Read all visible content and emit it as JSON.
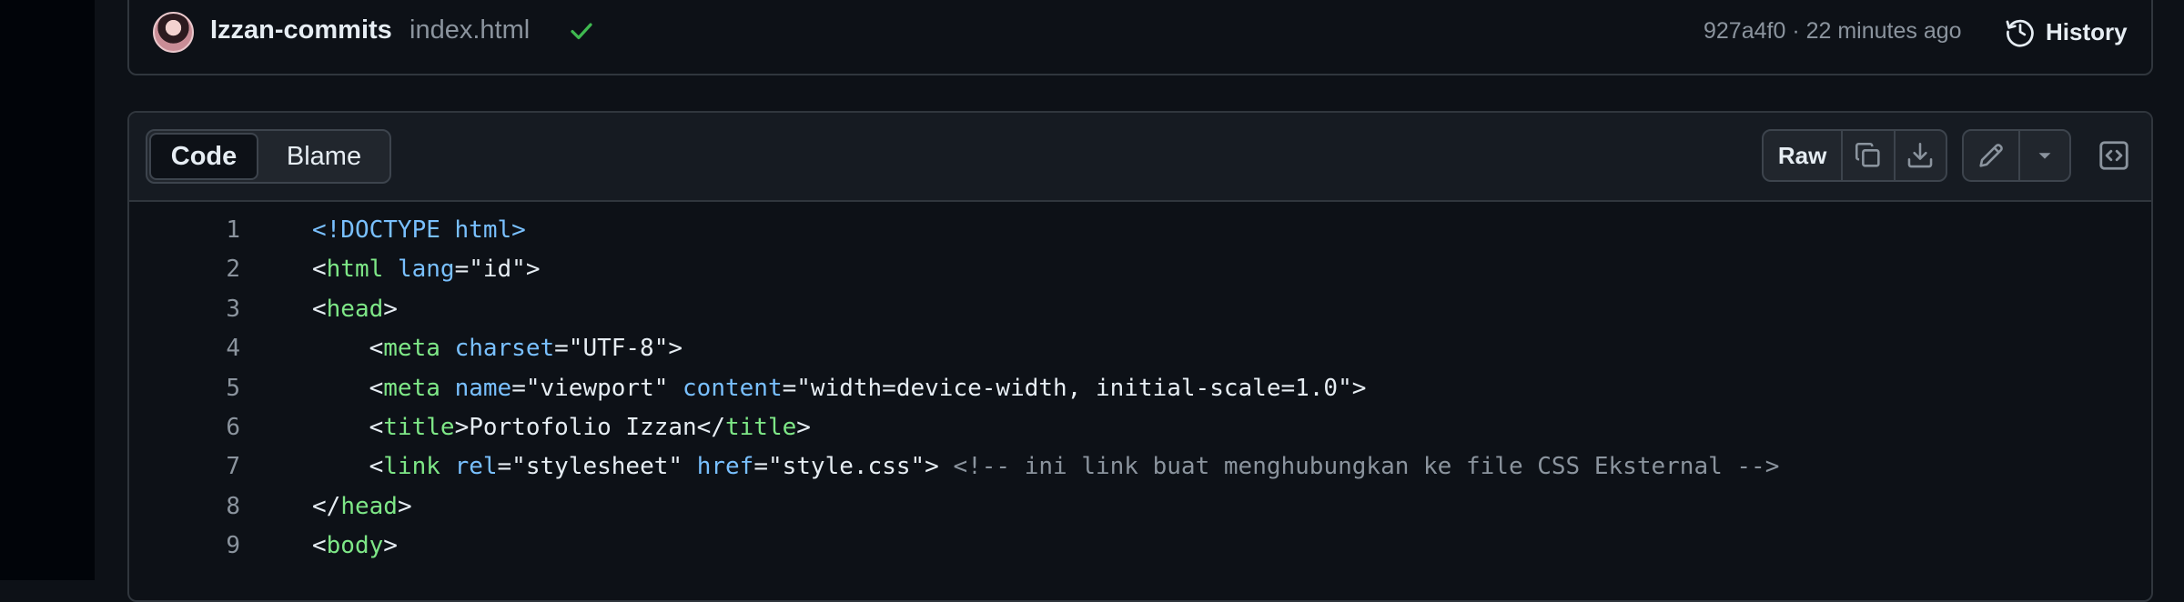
{
  "commit": {
    "author": "Izzan-commits",
    "filename": "index.html",
    "meta": "927a4f0 · 22 minutes ago",
    "history_label": "History"
  },
  "toolbar": {
    "code_tab": "Code",
    "blame_tab": "Blame",
    "raw_label": "Raw"
  },
  "colors": {
    "background": "#0d1117",
    "tag": "#7ee787",
    "attribute": "#79c0ff",
    "string": "#a5d6ff",
    "comment": "#8b949e",
    "check": "#3fb950"
  },
  "icons": [
    "history-icon",
    "copy-icon",
    "download-icon",
    "pencil-icon",
    "triangle-down-icon",
    "code-square-icon",
    "check-icon"
  ],
  "code_lines": [
    {
      "n": "1",
      "tokens": [
        [
          "doctype",
          "<!DOCTYPE html>"
        ]
      ]
    },
    {
      "n": "2",
      "tokens": [
        [
          "plain",
          "<"
        ],
        [
          "tag",
          "html"
        ],
        [
          "plain",
          " "
        ],
        [
          "attr",
          "lang"
        ],
        [
          "plain",
          "=\"id\">"
        ]
      ]
    },
    {
      "n": "3",
      "tokens": [
        [
          "plain",
          "<"
        ],
        [
          "tag",
          "head"
        ],
        [
          "plain",
          ">"
        ]
      ]
    },
    {
      "n": "4",
      "tokens": [
        [
          "plain",
          "    <"
        ],
        [
          "tag",
          "meta"
        ],
        [
          "plain",
          " "
        ],
        [
          "attr",
          "charset"
        ],
        [
          "plain",
          "=\"UTF-8\">"
        ]
      ]
    },
    {
      "n": "5",
      "tokens": [
        [
          "plain",
          "    <"
        ],
        [
          "tag",
          "meta"
        ],
        [
          "plain",
          " "
        ],
        [
          "attr",
          "name"
        ],
        [
          "plain",
          "=\"viewport\" "
        ],
        [
          "attr",
          "content"
        ],
        [
          "plain",
          "=\"width=device-width, initial-scale=1.0\">"
        ]
      ]
    },
    {
      "n": "6",
      "tokens": [
        [
          "plain",
          "    <"
        ],
        [
          "tag",
          "title"
        ],
        [
          "plain",
          ">Portofolio Izzan</"
        ],
        [
          "tag",
          "title"
        ],
        [
          "plain",
          ">"
        ]
      ]
    },
    {
      "n": "7",
      "tokens": [
        [
          "plain",
          "    <"
        ],
        [
          "tag",
          "link"
        ],
        [
          "plain",
          " "
        ],
        [
          "attr",
          "rel"
        ],
        [
          "plain",
          "=\"stylesheet\" "
        ],
        [
          "attr",
          "href"
        ],
        [
          "plain",
          "=\"style.css\"> "
        ],
        [
          "cmt",
          "<!-- ini link buat menghubungkan ke file CSS Eksternal -->"
        ]
      ]
    },
    {
      "n": "8",
      "tokens": [
        [
          "plain",
          "</"
        ],
        [
          "tag",
          "head"
        ],
        [
          "plain",
          ">"
        ]
      ]
    },
    {
      "n": "9",
      "tokens": [
        [
          "plain",
          "<"
        ],
        [
          "tag",
          "body"
        ],
        [
          "plain",
          ">"
        ]
      ]
    }
  ]
}
